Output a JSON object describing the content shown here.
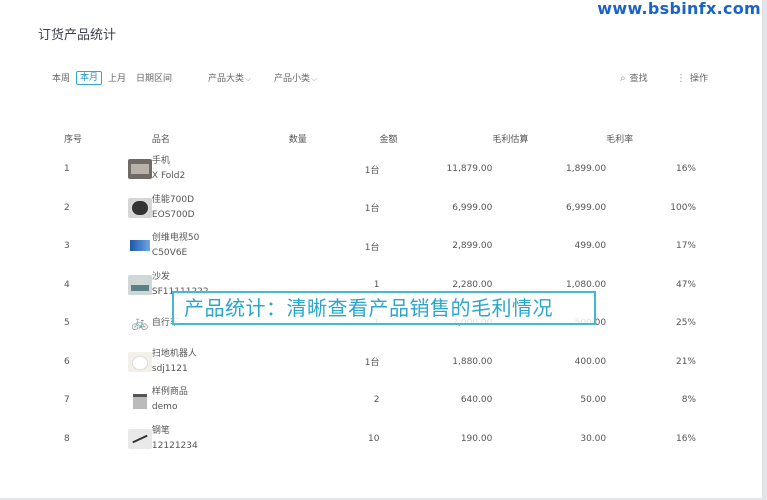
{
  "watermark": "www.bsbinfx.com",
  "page_title": "订货产品统计",
  "filters": {
    "period_week": "本周",
    "period_month": "本月",
    "period_last_month": "上月",
    "period_range": "日期区间",
    "category_big": "产品大类",
    "category_small": "产品小类",
    "search_label": "查找",
    "operations_label": "操作"
  },
  "table": {
    "headers": [
      "序号",
      "品名",
      "数量",
      "金额",
      "毛利估算",
      "毛利率"
    ],
    "rows": [
      {
        "idx": "1",
        "name": "手机",
        "code": "X Fold2",
        "qty": "1台",
        "amount": "11,879.00",
        "gross_profit": "1,899.00",
        "margin": "16%",
        "icon": "phone-image"
      },
      {
        "idx": "2",
        "name": "佳能700D",
        "code": "EOS700D",
        "qty": "1台",
        "amount": "6,999.00",
        "gross_profit": "6,999.00",
        "margin": "100%",
        "icon": "camera-image"
      },
      {
        "idx": "3",
        "name": "创维电视50",
        "code": "C50V6E",
        "qty": "1台",
        "amount": "2,899.00",
        "gross_profit": "499.00",
        "margin": "17%",
        "icon": "tv-image"
      },
      {
        "idx": "4",
        "name": "沙发",
        "code": "SF11111222",
        "qty": "1",
        "amount": "2,280.00",
        "gross_profit": "1,080.00",
        "margin": "47%",
        "icon": "sofa-image"
      },
      {
        "idx": "5",
        "name": "",
        "code": "自行车",
        "qty": "1",
        "amount": "2,000.00",
        "gross_profit": "500.00",
        "margin": "25%",
        "icon": "bike-image"
      },
      {
        "idx": "6",
        "name": "扫地机器人",
        "code": "sdj1121",
        "qty": "1台",
        "amount": "1,880.00",
        "gross_profit": "400.00",
        "margin": "21%",
        "icon": "robot-vacuum-image"
      },
      {
        "idx": "7",
        "name": "样例商品",
        "code": "demo",
        "qty": "2",
        "amount": "640.00",
        "gross_profit": "50.00",
        "margin": "8%",
        "icon": "demo-product-image"
      },
      {
        "idx": "8",
        "name": "钢笔",
        "code": "12121234",
        "qty": "10",
        "amount": "190.00",
        "gross_profit": "30.00",
        "margin": "16%",
        "icon": "pen-image"
      }
    ]
  },
  "banner_text": "产品统计：清晰查看产品销售的毛利情况",
  "colors": {
    "accent": "#2393cc",
    "banner": "#2aa6cc",
    "watermark": "#1a63c7"
  }
}
